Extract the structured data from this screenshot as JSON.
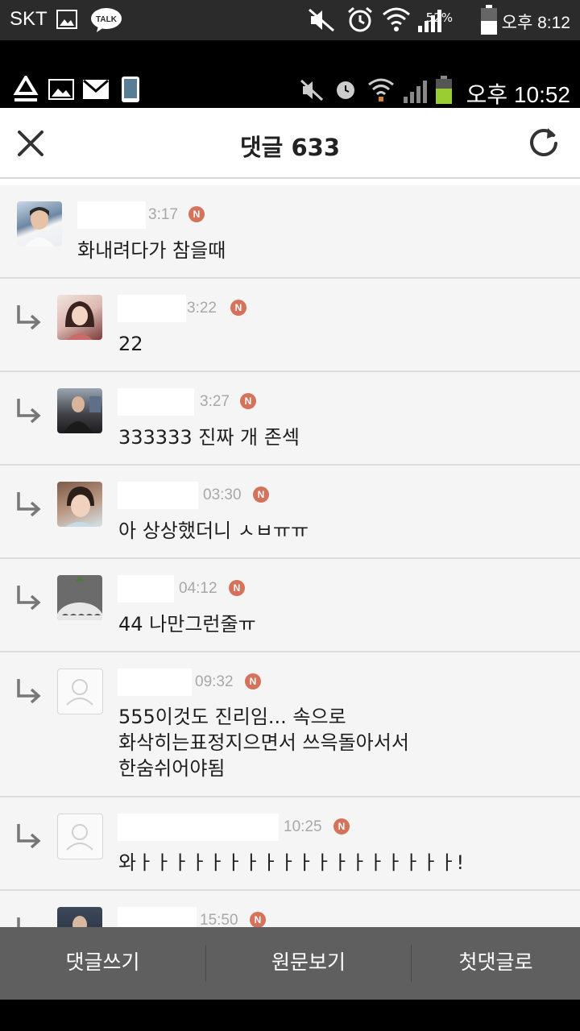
{
  "outer_status": {
    "carrier": "SKT",
    "battery": "52%",
    "time": "오후 8:12",
    "talk": "TALK"
  },
  "inner_status": {
    "time": "오후 10:52"
  },
  "header": {
    "title": "댓글 633"
  },
  "comments": [
    {
      "time": "3:17",
      "text": [
        "화내려다가 참을때"
      ],
      "reply": false
    },
    {
      "time": "3:22",
      "text": [
        "22"
      ],
      "reply": true
    },
    {
      "time": "3:27",
      "text": [
        "333333 진짜 개 존섹"
      ],
      "reply": true
    },
    {
      "time": "03:30",
      "text": [
        "아 상상했더니 ㅅㅂㅠㅠ"
      ],
      "reply": true
    },
    {
      "time": "04:12",
      "text": [
        "44 나만그런줄ㅠ"
      ],
      "reply": true
    },
    {
      "time": "09:32",
      "text": [
        "555이것도 진리임... 속으로",
        "화삭히는표정지으면서 쓰윽돌아서서",
        "한숨쉬어야됨"
      ],
      "reply": true
    },
    {
      "time": "10:25",
      "text": [
        "와ㅏㅏㅏㅏㅏㅏㅏㅏㅏㅏㅏㅏㅏㅏㅏㅏㅏㅏ!"
      ],
      "reply": true
    },
    {
      "time": "15:50",
      "text": [],
      "reply": true
    }
  ],
  "badge": "N",
  "bottom_bar": {
    "write": "댓글쓰기",
    "original": "원문보기",
    "first": "첫댓글로"
  },
  "colors": {
    "badge": "#d3735b",
    "bottom_bar": "#5f5f5f",
    "background": "#f5f5f5"
  },
  "icons": [
    "close-icon",
    "refresh-icon",
    "reply-arrow-icon",
    "default-avatar-icon"
  ]
}
